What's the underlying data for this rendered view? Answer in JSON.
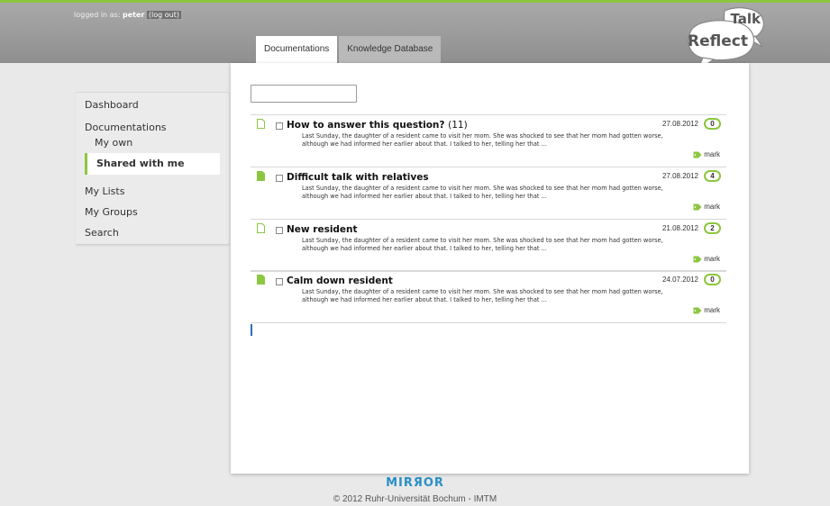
{
  "header": {
    "login_prefix": "logged in as:",
    "username": "peter",
    "logout": "(log out)"
  },
  "tabs": [
    {
      "label": "Documentations",
      "active": true
    },
    {
      "label": "Knowledge Database",
      "active": false
    }
  ],
  "logo": {
    "word1": "Talk",
    "word2": "Reflect"
  },
  "sidebar": {
    "items": [
      {
        "label": "Dashboard"
      },
      {
        "label": "Documentations"
      },
      {
        "label": "My own"
      },
      {
        "label": "Shared with me",
        "selected": true
      },
      {
        "label": "My Lists"
      },
      {
        "label": "My Groups"
      },
      {
        "label": "Search"
      }
    ]
  },
  "search": {
    "value": "",
    "placeholder": ""
  },
  "documents": [
    {
      "title": "How to answer this question?",
      "count": "(11)",
      "date": "27.08.2012",
      "comments": "0",
      "icon": "document-outline-icon",
      "excerpt": "Last Sunday, the daughter of a resident came to visit her mom. She was shocked to see that her mom had gotten worse, although we had informed her earlier about that. I talked to her, telling her that ...",
      "mark": "mark"
    },
    {
      "title": "Difficult talk with relatives",
      "count": "",
      "date": "27.08.2012",
      "comments": "4",
      "icon": "document-filled-icon",
      "excerpt": "Last Sunday, the daughter of a resident came to visit her mom. She was shocked to see that her mom had gotten worse, although we had informed her earlier about that. I talked to her, telling her that ...",
      "mark": "mark"
    },
    {
      "title": "New resident",
      "count": "",
      "date": "21.08.2012",
      "comments": "2",
      "icon": "document-outline-icon",
      "excerpt": "Last Sunday, the daughter of a resident came to visit her mom. She was shocked to see that her mom had gotten worse, although we had informed her earlier about that. I talked to her, telling her that ...",
      "mark": "mark"
    },
    {
      "title": "Calm down resident",
      "count": "",
      "date": "24.07.2012",
      "comments": "0",
      "icon": "document-filled-icon",
      "excerpt": "Last Sunday, the daughter of a resident came to visit her mom. She was shocked to see that her mom had gotten worse, although we had informed her earlier about that. I talked to her, telling her that ...",
      "mark": "mark"
    }
  ],
  "footer": {
    "logo": "MIRЯOR",
    "copyright": "© 2012 Ruhr-Universität Bochum - IMTM"
  },
  "colors": {
    "accent": "#8cc63f",
    "header": "#999999",
    "background": "#e9e9e9",
    "mirror_blue": "#2a8fc6"
  }
}
